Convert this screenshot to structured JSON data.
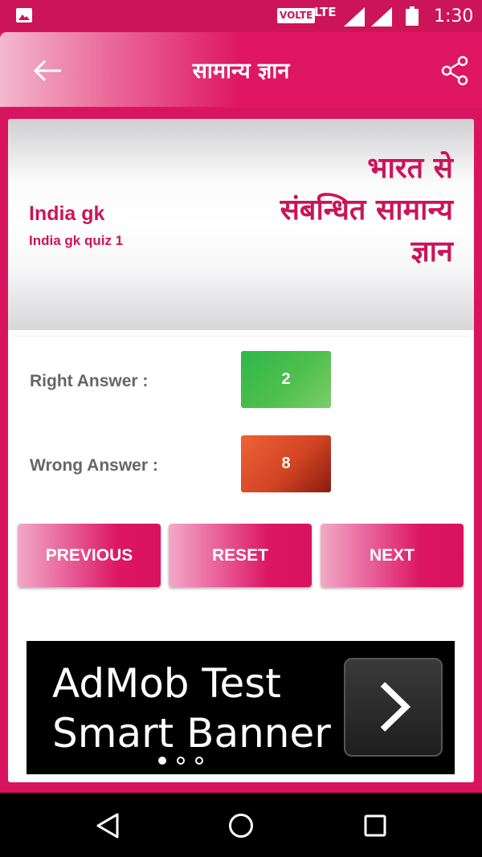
{
  "status_bar": {
    "volte": "VOLTE",
    "network": "LTE",
    "time": "1:30",
    "icons": [
      "image-icon",
      "signal-icon",
      "signal-icon",
      "battery-icon"
    ]
  },
  "header": {
    "title": "सामान्य ज्ञान",
    "back_icon": "arrow-left-icon",
    "share_icon": "share-icon"
  },
  "hero": {
    "title": "India gk",
    "subtitle": "India gk quiz 1",
    "hindi_line1": "भारत से",
    "hindi_line2": "संबन्धित सामान्य",
    "hindi_line3": "ज्ञान"
  },
  "score": {
    "right_label": "Right Answer :",
    "right_value": "2",
    "wrong_label": "Wrong Answer :",
    "wrong_value": "8"
  },
  "buttons": {
    "previous": "PREVIOUS",
    "reset": "RESET",
    "next": "NEXT"
  },
  "ad": {
    "line1": "AdMob Test",
    "line2": "Smart Banner",
    "arrow_icon": "chevron-right-icon"
  },
  "colors": {
    "accent": "#de1663",
    "right": "#3cb84a",
    "wrong": "#e0512e"
  }
}
